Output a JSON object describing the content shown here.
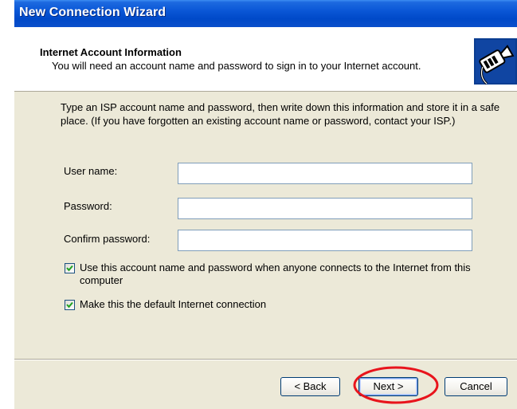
{
  "window": {
    "title": "New Connection Wizard"
  },
  "header": {
    "heading": "Internet Account Information",
    "subheading": "You will need an account name and password to sign in to your Internet account.",
    "icon": "network-cable-icon"
  },
  "body": {
    "instructions": "Type an ISP account name and password, then write down this information and store it in a safe place. (If you have forgotten an existing account name or password, contact your ISP.)",
    "fields": [
      {
        "label": "User name:",
        "value": ""
      },
      {
        "label": "Password:",
        "value": ""
      },
      {
        "label": "Confirm password:",
        "value": ""
      }
    ],
    "checkboxes": [
      {
        "label": "Use this account  name and password when anyone connects to the Internet from this computer",
        "checked": true
      },
      {
        "label": "Make this the default Internet connection",
        "checked": true
      }
    ]
  },
  "footer": {
    "back_label": "< Back",
    "next_label": "Next >",
    "cancel_label": "Cancel"
  },
  "colors": {
    "titlebar": "#0a56d6",
    "dialog_bg": "#ece9d8",
    "annotation": "#e8141c"
  }
}
